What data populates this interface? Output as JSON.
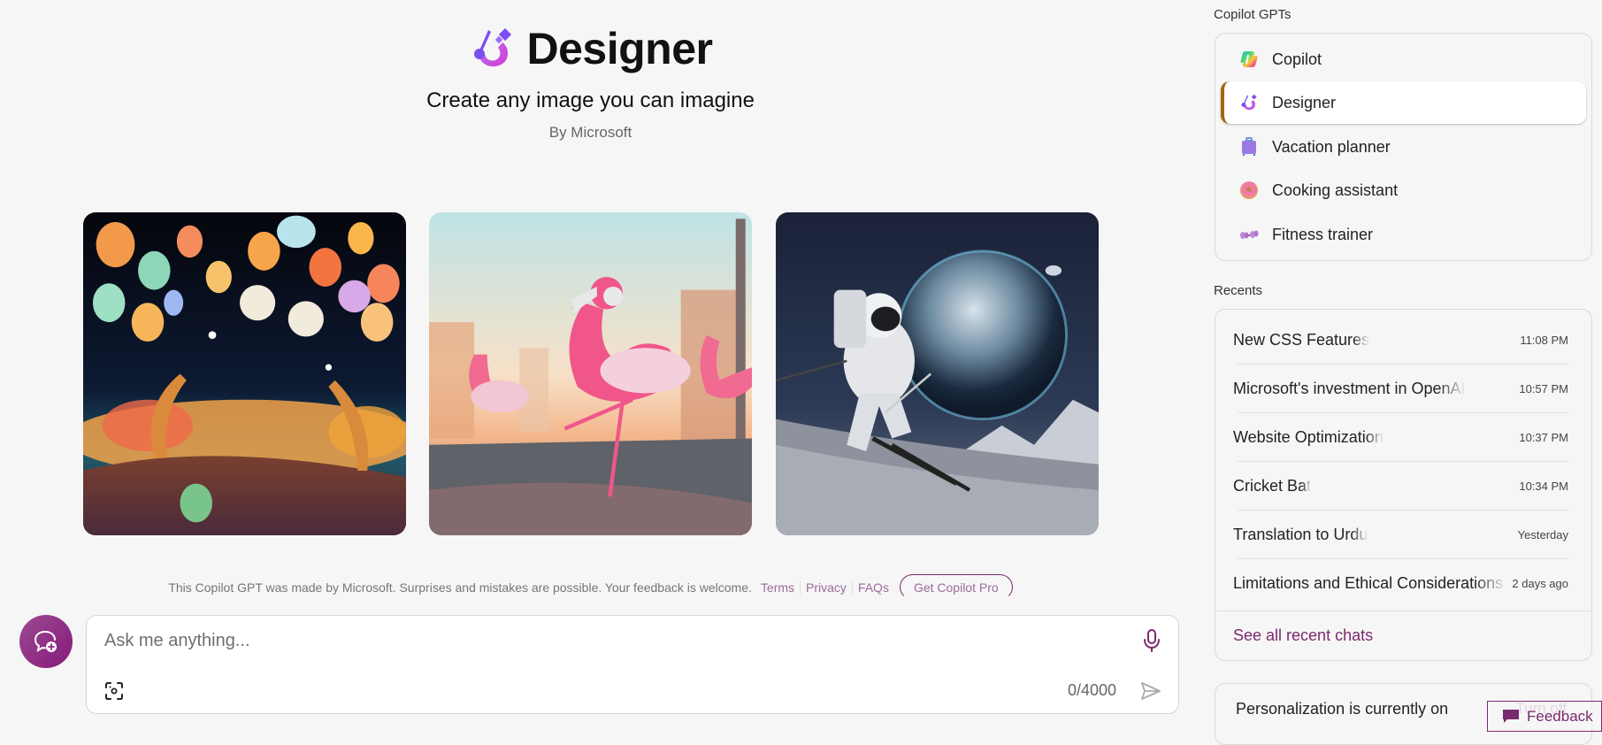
{
  "header": {
    "title": "Designer",
    "logo_icon": "designer-brush-icon",
    "subtitle": "Create any image you can imagine",
    "byline": "By Microsoft"
  },
  "gallery": [
    {
      "alt": "Glowing paper lanterns and moons over a fantasy garden at night"
    },
    {
      "alt": "Pink flamingo with headphones dancing on a city street at sunrise"
    },
    {
      "alt": "Astronaut skiing on the moon with Earth in the background"
    }
  ],
  "disclaimer": {
    "text": "This Copilot GPT was made by Microsoft. Surprises and mistakes are possible. Your feedback is welcome.",
    "links": [
      "Terms",
      "Privacy",
      "FAQs"
    ],
    "pro_button": "Get Copilot Pro"
  },
  "composer": {
    "new_chat_icon": "new-chat-icon",
    "placeholder": "Ask me anything...",
    "value": "",
    "counter": "0/4000",
    "mic_icon": "microphone-icon",
    "visual_search_icon": "visual-search-icon",
    "send_icon": "send-icon"
  },
  "sidebar": {
    "gpts_label": "Copilot GPTs",
    "gpts": [
      {
        "label": "Copilot",
        "icon": "copilot-icon",
        "active": false
      },
      {
        "label": "Designer",
        "icon": "designer-icon",
        "active": true
      },
      {
        "label": "Vacation planner",
        "icon": "suitcase-icon",
        "active": false
      },
      {
        "label": "Cooking assistant",
        "icon": "donut-icon",
        "active": false
      },
      {
        "label": "Fitness trainer",
        "icon": "dumbbell-icon",
        "active": false
      }
    ],
    "recents_label": "Recents",
    "recents": [
      {
        "title": "New CSS Features",
        "time": "11:08 PM"
      },
      {
        "title": "Microsoft's investment in OpenAI",
        "time": "10:57 PM"
      },
      {
        "title": "Website Optimization",
        "time": "10:37 PM"
      },
      {
        "title": "Cricket Bat",
        "time": "10:34 PM"
      },
      {
        "title": "Translation to Urdu",
        "time": "Yesterday"
      },
      {
        "title": "Limitations and Ethical Considerations for AI",
        "time": "2 days ago"
      }
    ],
    "see_all": "See all recent chats",
    "personalization": {
      "text": "Personalization is currently on",
      "action": "Turn off"
    }
  },
  "feedback": {
    "label": "Feedback",
    "icon": "feedback-icon"
  },
  "colors": {
    "accent": "#7a2a6e",
    "active_bar": "#a2680f",
    "background": "#f6f6f6"
  }
}
